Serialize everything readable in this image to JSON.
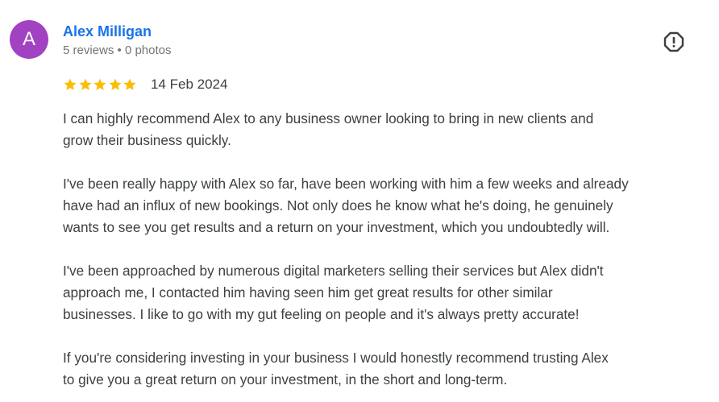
{
  "colors": {
    "avatar_bg": "#a142c2",
    "name_link": "#1a73e8",
    "star": "#fbbc04",
    "text": "#3c4043",
    "meta": "#70757a",
    "report_icon": "#3c4043"
  },
  "reviewer": {
    "avatar_letter": "A",
    "name": "Alex Milligan",
    "meta": "5 reviews • 0 photos"
  },
  "report": {
    "icon": "report-flag-icon"
  },
  "rating": {
    "stars": 5,
    "max_stars": 5,
    "date": "14 Feb 2024"
  },
  "review": {
    "paragraphs": [
      "I can highly recommend Alex to any business owner looking to bring in new clients and\ngrow their business quickly.",
      "I've been really happy with Alex so far, have been working with him a few weeks and already\nhave had an influx of new bookings. Not only does he know what he's doing, he genuinely\nwants to see you get results and a return on your investment, which you undoubtedly will.",
      "I've been approached by numerous digital marketers selling their services but Alex didn't\napproach me, I contacted him having seen him get great results for other similar\nbusinesses. I like to go with my gut feeling on people and it's always pretty accurate!",
      "If you're considering investing in your business I would honestly recommend trusting Alex\nto give you a great return on your investment, in the short and long-term."
    ]
  }
}
